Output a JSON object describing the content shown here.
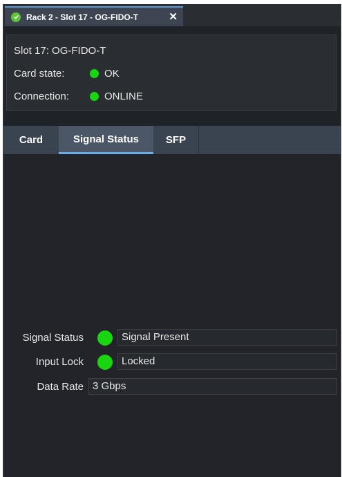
{
  "window": {
    "tab_title": "Rack 2 - Slot 17 - OG-FIDO-T",
    "close_glyph": "✕"
  },
  "info": {
    "title": "Slot 17: OG-FIDO-T",
    "card_state_label": "Card state:",
    "card_state_value": "OK",
    "connection_label": "Connection:",
    "connection_value": "ONLINE"
  },
  "tabs": [
    {
      "label": "Card"
    },
    {
      "label": "Signal Status",
      "active": true
    },
    {
      "label": "SFP"
    }
  ],
  "signal": {
    "signal_status_label": "Signal Status",
    "signal_status_value": "Signal Present",
    "input_lock_label": "Input Lock",
    "input_lock_value": "Locked",
    "data_rate_label": "Data Rate",
    "data_rate_value": "3 Gbps"
  },
  "colors": {
    "status_ok": "#19d610",
    "tab_accent": "#6aaee8",
    "background": "#1f2226"
  }
}
